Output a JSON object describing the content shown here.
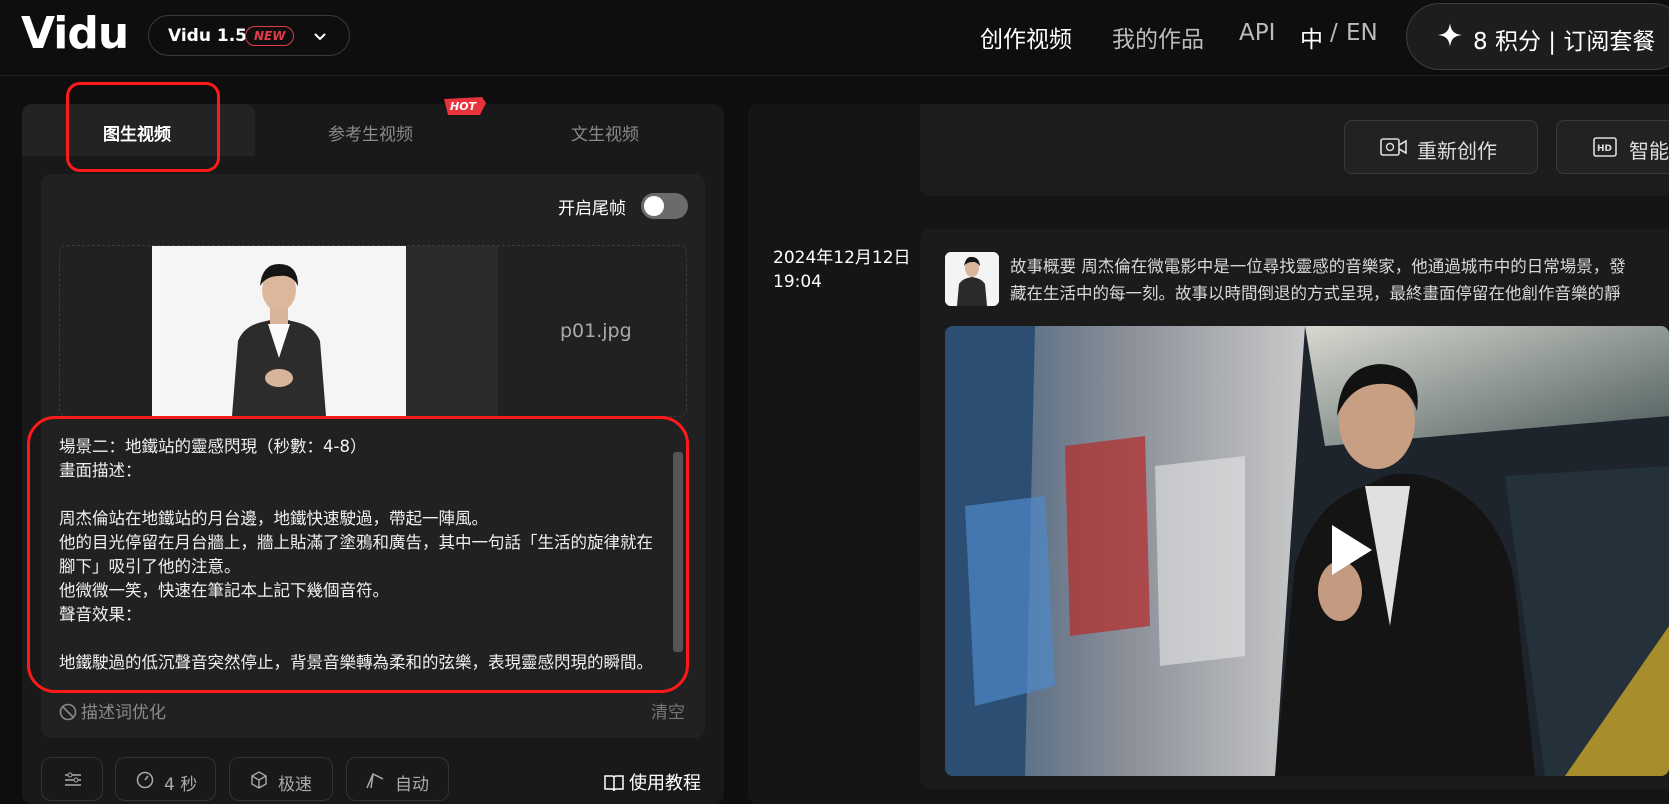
{
  "header": {
    "logo": "Vidu",
    "version_label": "Vidu 1.5",
    "new_badge": "NEW",
    "nav": [
      "创作视频",
      "我的作品",
      "API"
    ],
    "lang_zh": "中",
    "lang_sep": "/",
    "lang_en": "EN",
    "credits_label": "8 积分 | 订阅套餐"
  },
  "tabs": {
    "img2video": "图生视频",
    "ref2video": "参考生视频",
    "text2video": "文生视频",
    "hot_badge": "HOT"
  },
  "panel": {
    "end_frame_label": "开启尾帧",
    "end_frame_on": false,
    "file_name": "p01.jpg",
    "prompt_text": "場景二：地鐵站的靈感閃現（秒數：4-8）\n畫面描述：\n\n周杰倫站在地鐵站的月台邊，地鐵快速駛過，帶起一陣風。\n他的目光停留在月台牆上，牆上貼滿了塗鴉和廣告，其中一句話「生活的旋律就在腳下」吸引了他的注意。\n他微微一笑，快速在筆記本上記下幾個音符。\n聲音效果：\n\n地鐵駛過的低沉聲音突然停止，背景音樂轉為柔和的弦樂，表現靈感閃現的瞬間。",
    "optimize_label": "描述词优化",
    "clear_label": "清空",
    "duration": "4 秒",
    "speed": "极速",
    "mode": "自动",
    "tutorial": "使用教程"
  },
  "right": {
    "recreate_button": "重新创作",
    "hd_button": "智能",
    "date": "2024年12月12日\n19:04",
    "story_line1": "故事概要 周杰倫在微電影中是一位尋找靈感的音樂家，他通過城市中的日常場景，發",
    "story_line2": "藏在生活中的每一刻。故事以時間倒退的方式呈現，最終畫面停留在他創作音樂的靜"
  },
  "colors": {
    "accent_red": "#ff1a1a",
    "new_badge": "#e33b4a",
    "background": "#0e0e0e"
  }
}
